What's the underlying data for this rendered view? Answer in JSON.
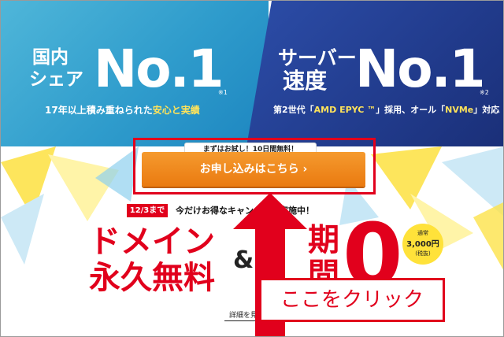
{
  "hero": {
    "left": {
      "line1": "国内",
      "line2": "シェア",
      "big": "No.1",
      "note": "※1",
      "sub_prefix": "17年以上積み重ねられた",
      "sub_highlight": "安心と実績"
    },
    "right": {
      "line1": "サーバー",
      "line2": "速度",
      "big": "No.1",
      "note": "※2",
      "sub_prefix": "第2世代「",
      "sub_highlight1": "AMD EPYC ™",
      "sub_mid": "」採用、オール「",
      "sub_highlight2": "NVMe",
      "sub_suffix": "」対応"
    }
  },
  "cta": {
    "trial_label": "まずはお試し！10日間無料！",
    "button_label": "お申し込みはこちら ›"
  },
  "campaign": {
    "date_badge": "12/3まで",
    "headline": "今だけお得なキャン　　ン実施中！",
    "domain_line1": "ドメイン",
    "domain_line2": "永久無料",
    "amp": "&",
    "period_line1": "期",
    "period_line2": "間",
    "zero": "0",
    "yen": "円",
    "badge_line1": "通常",
    "badge_price": "3,000円",
    "badge_tax": "(税抜)",
    "details_link": "詳細を見"
  },
  "annotation": {
    "callout_text": "ここをクリック"
  },
  "colors": {
    "accent_red": "#e1001c",
    "cta_orange": "#f08a1e",
    "hero_blue_left": "#2f9ccc",
    "hero_blue_right": "#213b8c",
    "highlight_yellow": "#ffe35a"
  }
}
